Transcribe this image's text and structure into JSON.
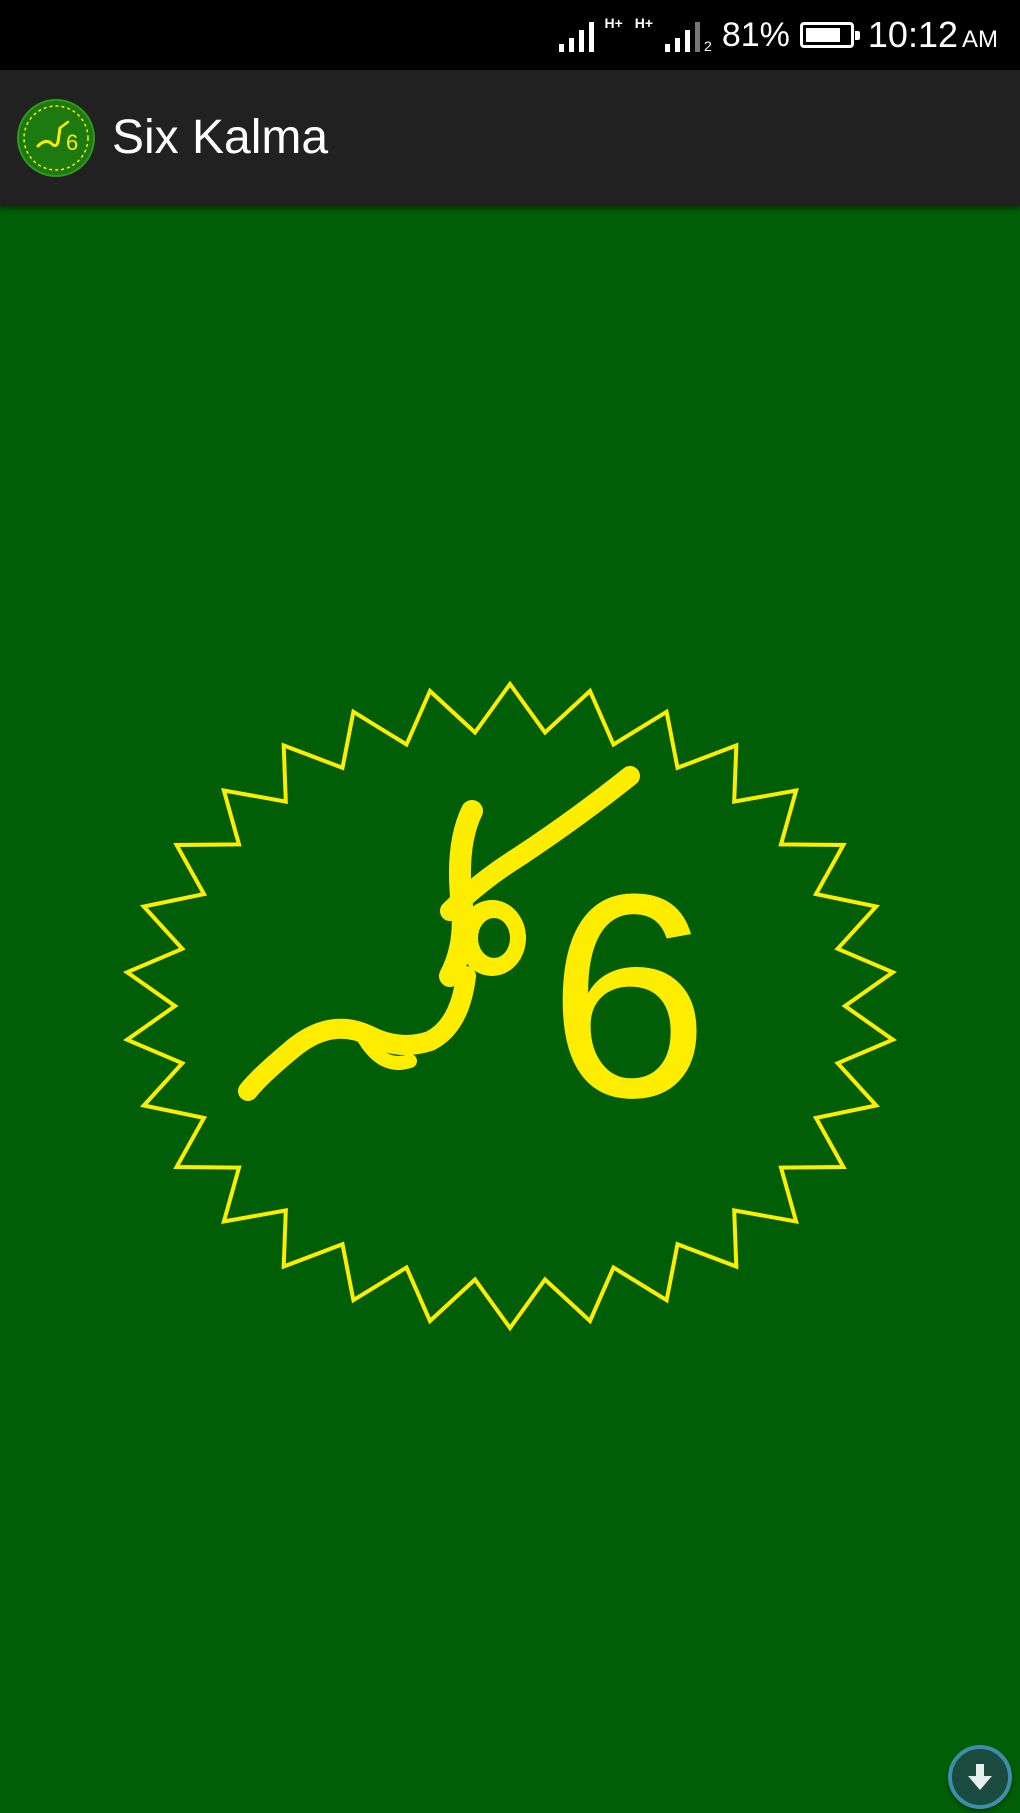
{
  "status_bar": {
    "network_labels": [
      "H+",
      "H+"
    ],
    "sim2_label": "2",
    "battery_percent": "81%",
    "battery_level": 0.81,
    "time": "10:12",
    "ampm": "AM"
  },
  "app_bar": {
    "title": "Six Kalma",
    "logo_icon": "six-kalma-logo-icon"
  },
  "splash": {
    "logo_icon": "six-kalma-starburst-logo-icon",
    "logo_number": "6"
  },
  "fab": {
    "icon": "download-arrow-icon"
  },
  "colors": {
    "background_green": "#005f06",
    "accent_yellow": "#ffed00",
    "app_bar": "#212121",
    "status_bar": "#000000"
  }
}
